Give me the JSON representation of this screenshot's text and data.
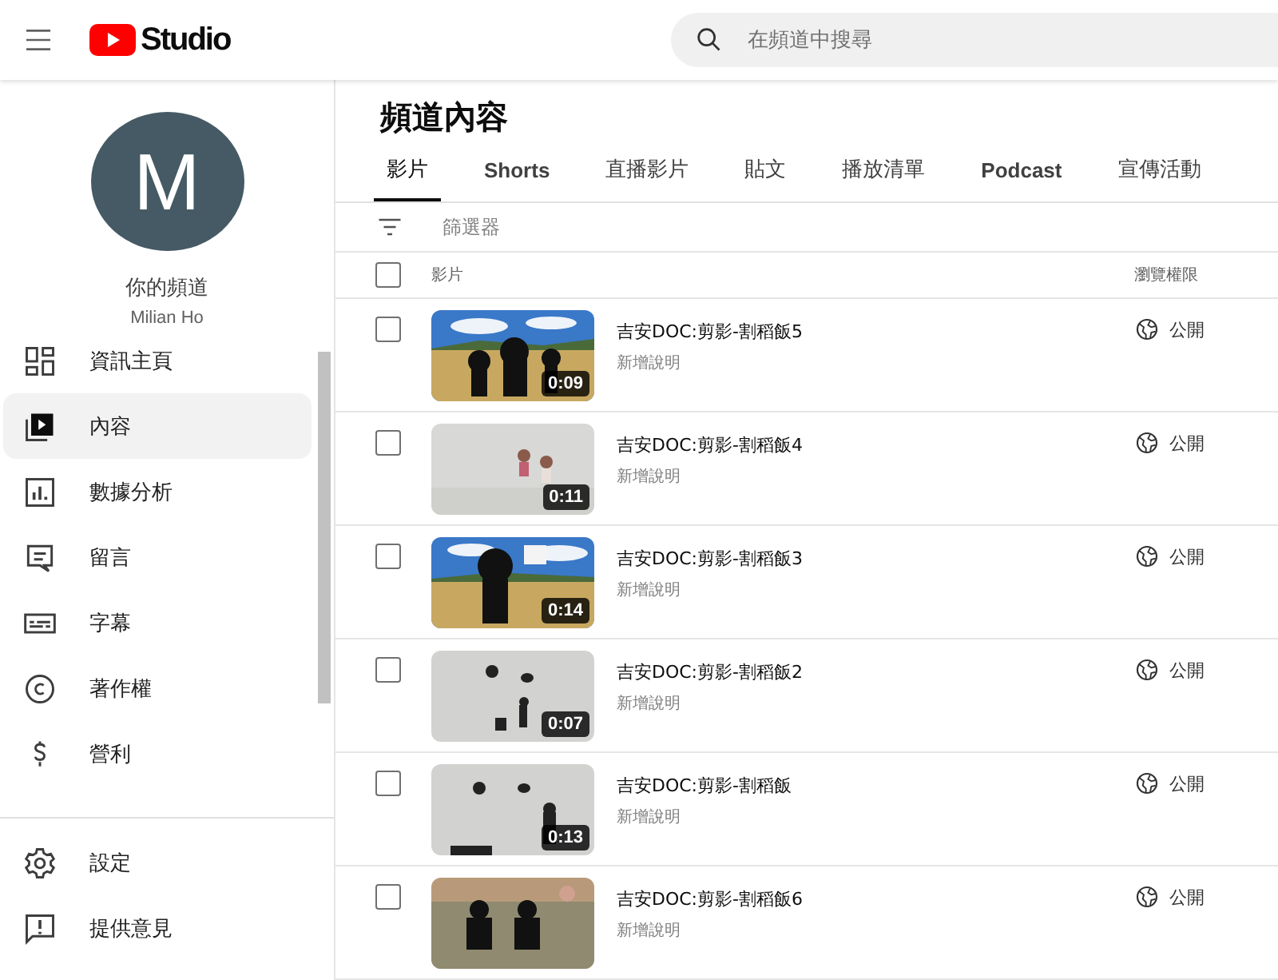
{
  "header": {
    "logo_text": "Studio",
    "search": {
      "placeholder": "在頻道中搜尋"
    }
  },
  "sidebar": {
    "avatar_letter": "M",
    "channel_label": "你的頻道",
    "channel_name": "Milian Ho",
    "items": [
      {
        "kind": "dashboard",
        "label": "資訊主頁",
        "selected": false
      },
      {
        "kind": "content",
        "label": "內容",
        "selected": true
      },
      {
        "kind": "analytics",
        "label": "數據分析",
        "selected": false
      },
      {
        "kind": "comments",
        "label": "留言",
        "selected": false
      },
      {
        "kind": "subtitles",
        "label": "字幕",
        "selected": false
      },
      {
        "kind": "copyright",
        "label": "著作權",
        "selected": false
      },
      {
        "kind": "earn",
        "label": "營利",
        "selected": false
      }
    ],
    "footer_items": [
      {
        "kind": "settings",
        "label": "設定"
      },
      {
        "kind": "feedback",
        "label": "提供意見"
      }
    ]
  },
  "page_title": "頻道內容",
  "tabs": [
    {
      "label": "影片",
      "selected": true
    },
    {
      "label": "Shorts",
      "selected": false
    },
    {
      "label": "直播影片",
      "selected": false
    },
    {
      "label": "貼文",
      "selected": false
    },
    {
      "label": "播放清單",
      "selected": false
    },
    {
      "label": "Podcast",
      "selected": false
    },
    {
      "label": "宣傳活動",
      "selected": false
    }
  ],
  "filter": {
    "placeholder": "篩選器"
  },
  "table": {
    "select_all_checked": false,
    "columns": [
      "影片",
      "瀏覽權限"
    ],
    "rows": [
      {
        "checked": false,
        "title": "吉安DOC:剪影-割稻飯5",
        "description": "新增說明",
        "duration": "0:09",
        "visibility": "公開"
      },
      {
        "checked": false,
        "title": "吉安DOC:剪影-割稻飯4",
        "description": "新增說明",
        "duration": "0:11",
        "visibility": "公開"
      },
      {
        "checked": false,
        "title": "吉安DOC:剪影-割稻飯3",
        "description": "新增說明",
        "duration": "0:14",
        "visibility": "公開"
      },
      {
        "checked": false,
        "title": "吉安DOC:剪影-割稻飯2",
        "description": "新增說明",
        "duration": "0:07",
        "visibility": "公開"
      },
      {
        "checked": false,
        "title": "吉安DOC:剪影-割稻飯",
        "description": "新增說明",
        "duration": "0:13",
        "visibility": "公開"
      },
      {
        "checked": false,
        "title": "吉安DOC:剪影-割稻飯6",
        "description": "新增說明",
        "visibility": "公開"
      }
    ]
  }
}
